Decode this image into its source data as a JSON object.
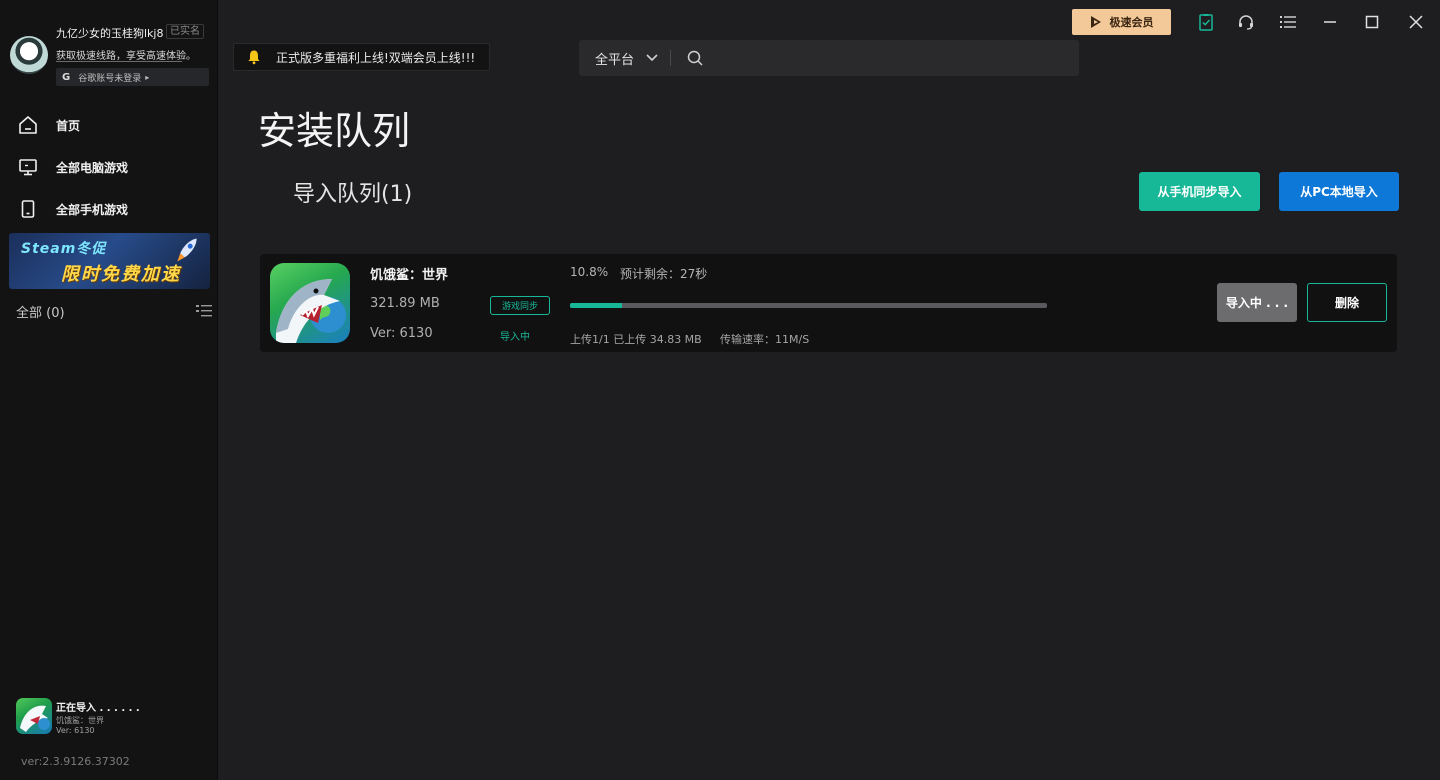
{
  "sidebar": {
    "username": "九亿少女的玉桂狗lkj8",
    "verified_badge": "已实名",
    "promo_text": "获取极速线路，享受高速体验。",
    "google_label": "谷歌账号未登录",
    "google_letter": "G",
    "nav": [
      {
        "label": "首页",
        "icon": "home-icon"
      },
      {
        "label": "全部电脑游戏",
        "icon": "monitor-icon"
      },
      {
        "label": "全部手机游戏",
        "icon": "phone-icon"
      }
    ],
    "banner": {
      "line1": "Steam冬促",
      "line2": "限时免费加速"
    },
    "filter_label": "全部 (0)",
    "now_importing": {
      "status": "正在导入 . . . . . .",
      "game": "饥饿鲨：世界",
      "version": "Ver: 6130"
    },
    "app_version": "ver:2.3.9126.37302"
  },
  "topbar": {
    "notice": "正式版多重福利上线!双端会员上线!!!",
    "platform_select": "全平台",
    "search_placeholder": "",
    "vip_label": "极速会员"
  },
  "main": {
    "title": "安装队列",
    "queue_title": "导入队列(1)",
    "btn_sync_phone": "从手机同步导入",
    "btn_pc_import": "从PC本地导入"
  },
  "queue": [
    {
      "name": "饥饿鲨：世界",
      "size": "321.89 MB",
      "version": "Ver: 6130",
      "tag": "游戏同步",
      "status": "导入中",
      "progress_text": "10.8%",
      "progress": 0.108,
      "eta": "预计剩余：27秒",
      "upload": "上传1/1 已上传 34.83 MB",
      "speed": "传输速率：11M/S",
      "btn_status": "导入中 . . .",
      "btn_delete": "删除"
    }
  ],
  "colors": {
    "accent": "#17b897",
    "blue": "#0d78d8",
    "vip": "#f3c99a"
  }
}
